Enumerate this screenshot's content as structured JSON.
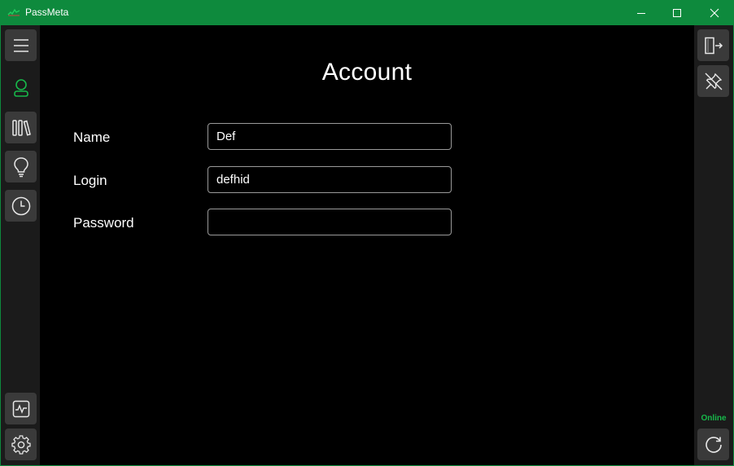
{
  "window": {
    "title": "PassMeta",
    "controls": [
      "minimize-icon",
      "maximize-icon",
      "close-icon"
    ]
  },
  "left_sidebar": {
    "items": [
      {
        "name": "menu",
        "icon": "hamburger-menu-icon",
        "active": false
      },
      {
        "name": "account",
        "icon": "user-icon",
        "active": true
      },
      {
        "name": "storage",
        "icon": "library-books-icon",
        "active": false
      },
      {
        "name": "generator",
        "icon": "lightbulb-icon",
        "active": false
      },
      {
        "name": "history",
        "icon": "clock-icon",
        "active": false
      }
    ],
    "bottom_items": [
      {
        "name": "journal",
        "icon": "activity-chart-icon"
      },
      {
        "name": "settings",
        "icon": "gear-icon"
      }
    ]
  },
  "main": {
    "title": "Account",
    "fields": [
      {
        "label": "Name",
        "value": "Def",
        "placeholder": ""
      },
      {
        "label": "Login",
        "value": "defhid",
        "placeholder": ""
      },
      {
        "label": "Password",
        "value": "",
        "placeholder": ""
      }
    ]
  },
  "right_sidebar": {
    "buttons": [
      {
        "name": "logout",
        "icon": "logout-door-icon"
      },
      {
        "name": "unpin",
        "icon": "pin-off-icon"
      }
    ],
    "status": "Online",
    "refresh_icon": "refresh-icon"
  },
  "colors": {
    "titlebar": "#0e8a3d",
    "accent_green": "#17b84a",
    "sidebar_bg": "#1b1b1b",
    "button_bg": "#3a3a3a",
    "content_bg": "#000000"
  }
}
